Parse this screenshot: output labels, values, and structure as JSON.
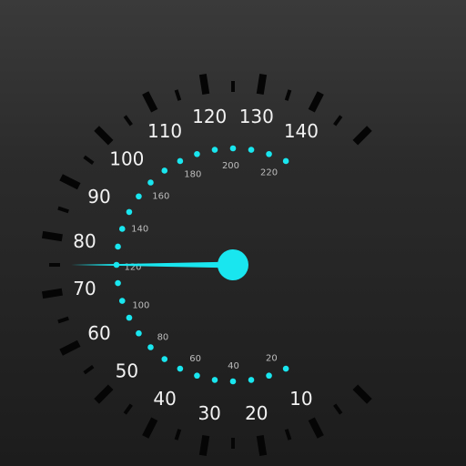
{
  "speedometer": {
    "primary_scale": {
      "labels": [
        "10",
        "20",
        "30",
        "40",
        "50",
        "60",
        "70",
        "80",
        "90",
        "100",
        "110",
        "120",
        "130",
        "140"
      ],
      "values": [
        10,
        20,
        30,
        40,
        50,
        60,
        70,
        80,
        90,
        100,
        110,
        120,
        130,
        140
      ]
    },
    "secondary_scale": {
      "labels": [
        "20",
        "40",
        "60",
        "80",
        "100",
        "120",
        "140",
        "160",
        "180",
        "200",
        "220"
      ],
      "values": [
        20,
        40,
        60,
        80,
        100,
        120,
        140,
        160,
        180,
        200,
        220
      ]
    },
    "needle_value": 75,
    "colors": {
      "accent": "#19e6ef",
      "primary_text": "#f2f2f2",
      "secondary_text": "#bdbdbd",
      "tick": "#050505"
    }
  }
}
